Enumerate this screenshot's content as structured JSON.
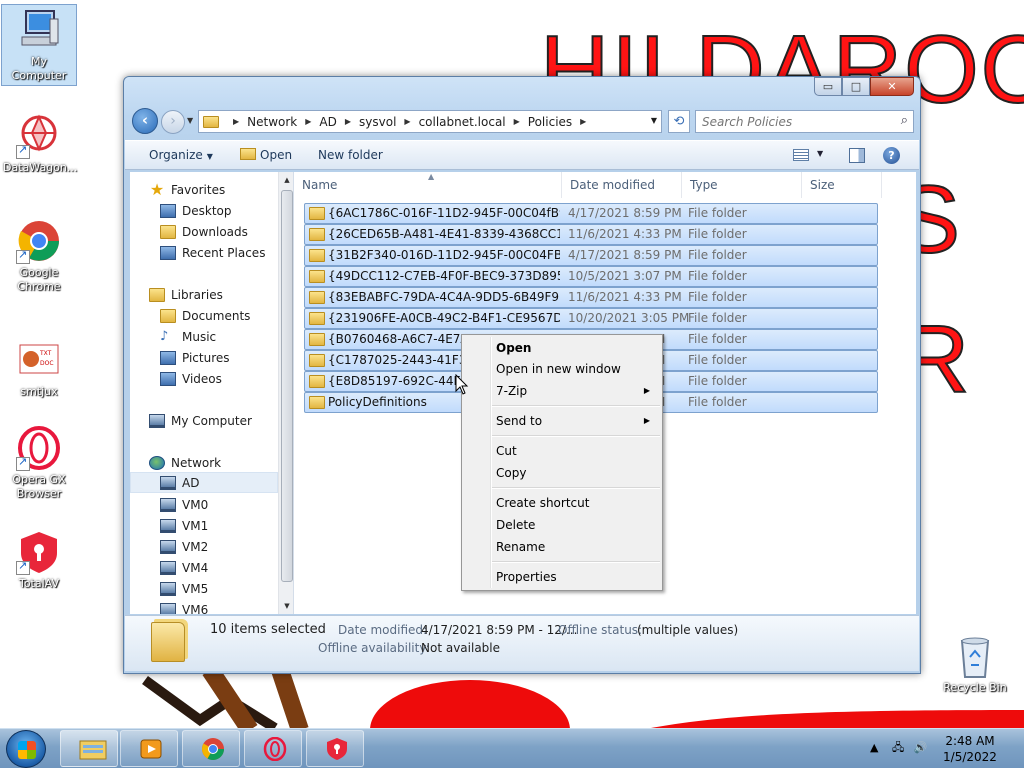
{
  "wallpaper": {
    "line1": "HILDAROO",
    "line2": "ES",
    "line3": "R"
  },
  "desktop": {
    "icons": [
      {
        "label": "My Computer",
        "icon": "computer-icon"
      },
      {
        "label": "DataWagon...",
        "icon": "datawagon-icon"
      },
      {
        "label": "Google Chrome",
        "icon": "chrome-icon"
      },
      {
        "label": "smtjux",
        "icon": "smtjux-icon"
      },
      {
        "label": "Opera GX Browser",
        "icon": "opera-gx-icon"
      },
      {
        "label": "TotalAV",
        "icon": "totalav-icon"
      },
      {
        "label": "Recycle Bin",
        "icon": "recycle-bin-icon"
      }
    ]
  },
  "window": {
    "controls": {
      "minimize": "▭",
      "maximize": "□",
      "close": "✕"
    },
    "breadcrumb": [
      "Network",
      "AD",
      "sysvol",
      "collabnet.local",
      "Policies"
    ],
    "search_placeholder": "Search Policies",
    "toolbar": {
      "organize": "Organize",
      "open": "Open",
      "new_folder": "New folder"
    },
    "nav": {
      "favorites": "Favorites",
      "desktop": "Desktop",
      "downloads": "Downloads",
      "recent_places": "Recent Places",
      "libraries": "Libraries",
      "documents": "Documents",
      "music": "Music",
      "pictures": "Pictures",
      "videos": "Videos",
      "my_computer": "My Computer",
      "network": "Network",
      "hosts": [
        "AD",
        "VM0",
        "VM1",
        "VM2",
        "VM4",
        "VM5",
        "VM6"
      ]
    },
    "columns": {
      "name": "Name",
      "date": "Date modified",
      "type": "Type",
      "size": "Size"
    },
    "rows": [
      {
        "name": "{6AC1786C-016F-11D2-945F-00C04fB984...",
        "date": "4/17/2021 8:59 PM",
        "type": "File folder"
      },
      {
        "name": "{26CED65B-A481-4E41-8339-4368CC1975...",
        "date": "11/6/2021 4:33 PM",
        "type": "File folder"
      },
      {
        "name": "{31B2F340-016D-11D2-945F-00C04FB984...",
        "date": "4/17/2021 8:59 PM",
        "type": "File folder"
      },
      {
        "name": "{49DCC112-C7EB-4F0F-BEC9-373D8953E...",
        "date": "10/5/2021 3:07 PM",
        "type": "File folder"
      },
      {
        "name": "{83EBABFC-79DA-4C4A-9DD5-6B49F9ED...",
        "date": "11/6/2021 4:33 PM",
        "type": "File folder"
      },
      {
        "name": "{231906FE-A0CB-49C2-B4F1-CE9567D1F0...",
        "date": "10/20/2021 3:05 PM",
        "type": "File folder"
      },
      {
        "name": "{B0760468-A6C7-4E7A-A0",
        "date": "",
        "type": "File folder"
      },
      {
        "name": "{C1787025-2443-41F3-A90",
        "date": "",
        "type": "File folder"
      },
      {
        "name": "{E8D85197-692C-44FC-A",
        "date": "",
        "type": "File folder"
      },
      {
        "name": "PolicyDefinitions",
        "date": "",
        "type": "File folder"
      }
    ],
    "hidden_date_suffix": "M",
    "details": {
      "selected": "10 items selected",
      "date_label": "Date modified:",
      "date_value": "4/17/2021 8:59 PM - 12/...",
      "offline_status_label": "Offline status:",
      "offline_status_value": "(multiple values)",
      "offline_avail_label": "Offline availability:",
      "offline_avail_value": "Not available"
    }
  },
  "context_menu": {
    "open": "Open",
    "open_new_window": "Open in new window",
    "seven_zip": "7-Zip",
    "send_to": "Send to",
    "cut": "Cut",
    "copy": "Copy",
    "create_shortcut": "Create shortcut",
    "delete": "Delete",
    "rename": "Rename",
    "properties": "Properties"
  },
  "taskbar": {
    "clock_time": "2:48 AM",
    "clock_date": "1/5/2022",
    "pinned": [
      "explorer-icon",
      "media-player-icon",
      "chrome-icon",
      "opera-gx-icon",
      "totalav-icon"
    ]
  },
  "colors": {
    "selection": "#c1dbfc",
    "selection_border": "#7da2ce",
    "wallpaper_text": "#ff1414"
  }
}
